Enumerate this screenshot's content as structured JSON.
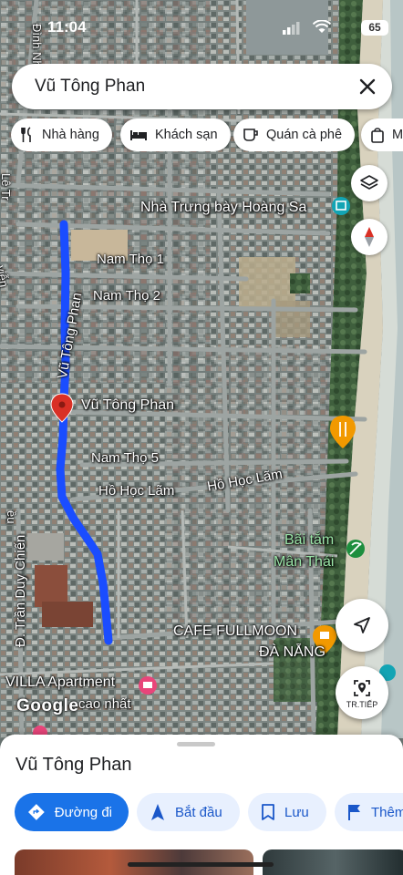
{
  "status_bar": {
    "time": "11:04",
    "battery": "65"
  },
  "search": {
    "query": "Vũ Tông Phan"
  },
  "chips": [
    {
      "label": "Nhà hàng",
      "icon": "fork-knife-icon"
    },
    {
      "label": "Khách sạn",
      "icon": "bed-icon"
    },
    {
      "label": "Quán cà phê",
      "icon": "coffee-cup-icon"
    },
    {
      "label": "Mu",
      "icon": "shopping-bag-icon"
    }
  ],
  "map": {
    "labels": {
      "museum": "Nhà Trưng bày Hoàng Sa",
      "nam_tho_1": "Nam Thọ 1",
      "nam_tho_2": "Nam Thọ 2",
      "route_street": "Vũ Tông Phan",
      "pin": "Vũ Tông Phan",
      "nam_tho_5": "Nam Thọ 5",
      "ho_hoc_lam_1": "Hồ Học Lãm",
      "ho_hoc_lam_2": "Hồ Học Lãm",
      "beach_1": "Bãi tắm",
      "beach_2": "Mân Thái",
      "cafe_1": "CAFE FULLMOON",
      "cafe_2": "ĐÀ NẴNG",
      "tran_duy_chien": "Đ. Trần Duy Chiến",
      "villa": "VILLA Apartment",
      "villa_sub": "cao nhất",
      "top_left_street": "Đình Nhật",
      "le_street": "Lê Tr",
      "vien": "viễn",
      "eu": "ều"
    },
    "google": "Google",
    "navigate_caption": "TR.TIẾP"
  },
  "colors": {
    "route": "#1a4dff",
    "accent": "#1a73e8",
    "pin": "#d93025",
    "place_orange": "#f29900",
    "place_green": "#1e8e3e",
    "compass_red": "#d93025"
  },
  "place": {
    "title": "Vũ Tông Phan",
    "actions": [
      {
        "label": "Đường đi",
        "icon": "directions-icon"
      },
      {
        "label": "Bắt đầu",
        "icon": "navigation-arrow-icon"
      },
      {
        "label": "Lưu",
        "icon": "bookmark-icon"
      },
      {
        "label": "Thêm",
        "icon": "flag-icon"
      }
    ]
  }
}
